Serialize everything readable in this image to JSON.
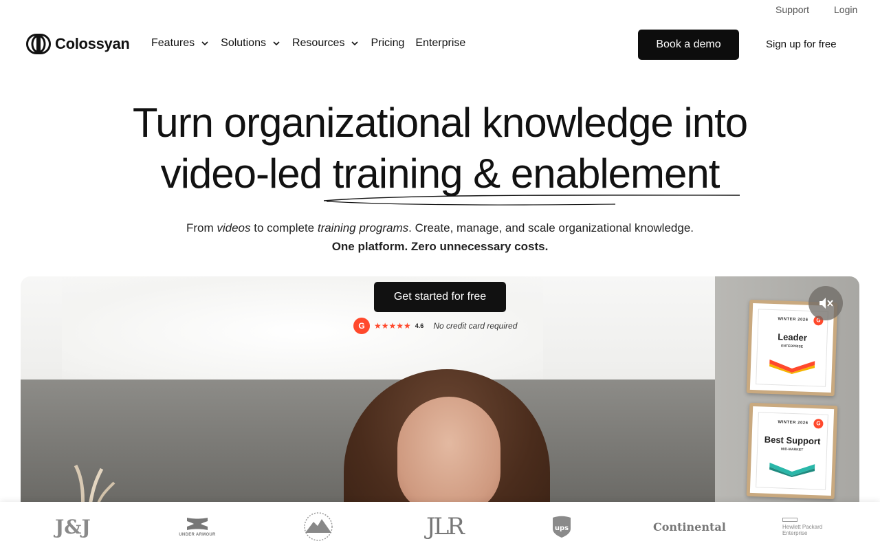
{
  "topbar": {
    "support": "Support",
    "login": "Login"
  },
  "nav": {
    "brand": "Colossyan",
    "items": [
      {
        "label": "Features",
        "dropdown": true
      },
      {
        "label": "Solutions",
        "dropdown": true
      },
      {
        "label": "Resources",
        "dropdown": true
      },
      {
        "label": "Pricing",
        "dropdown": false
      },
      {
        "label": "Enterprise",
        "dropdown": false
      }
    ],
    "demo_button": "Book a demo",
    "signup_link": "Sign up for free"
  },
  "hero": {
    "line1": "Turn organizational knowledge into",
    "line2_plain": "video-led ",
    "line2_highlight": "training & enablement",
    "sub_from": "From ",
    "sub_videos": "videos",
    "sub_to": " to complete ",
    "sub_programs": "training programs",
    "sub_rest": ". Create, manage, and scale organizational knowledge.",
    "sub_line2": "One platform. Zero unnecessary costs.",
    "cta": "Get started for free",
    "rating_value": "4.6",
    "rating_stars": 4.5,
    "rating_stars_text": "★★★★★",
    "no_cc": "No credit card required",
    "g2_letter": "G"
  },
  "badges": [
    {
      "season": "WINTER 2026",
      "name": "Leader",
      "segment": "ENTERPRISE"
    },
    {
      "season": "WINTER 2026",
      "name": "Best Support",
      "segment": "MID-MARKET"
    }
  ],
  "logos": {
    "jj": "J&J",
    "ua_caption": "UNDER ARMOUR",
    "jlr": "JLR",
    "continental": "Continental",
    "hpe_line1": "Hewlett Packard",
    "hpe_line2": "Enterprise"
  },
  "colors": {
    "primary": "#111111",
    "g2": "#ff492c"
  }
}
